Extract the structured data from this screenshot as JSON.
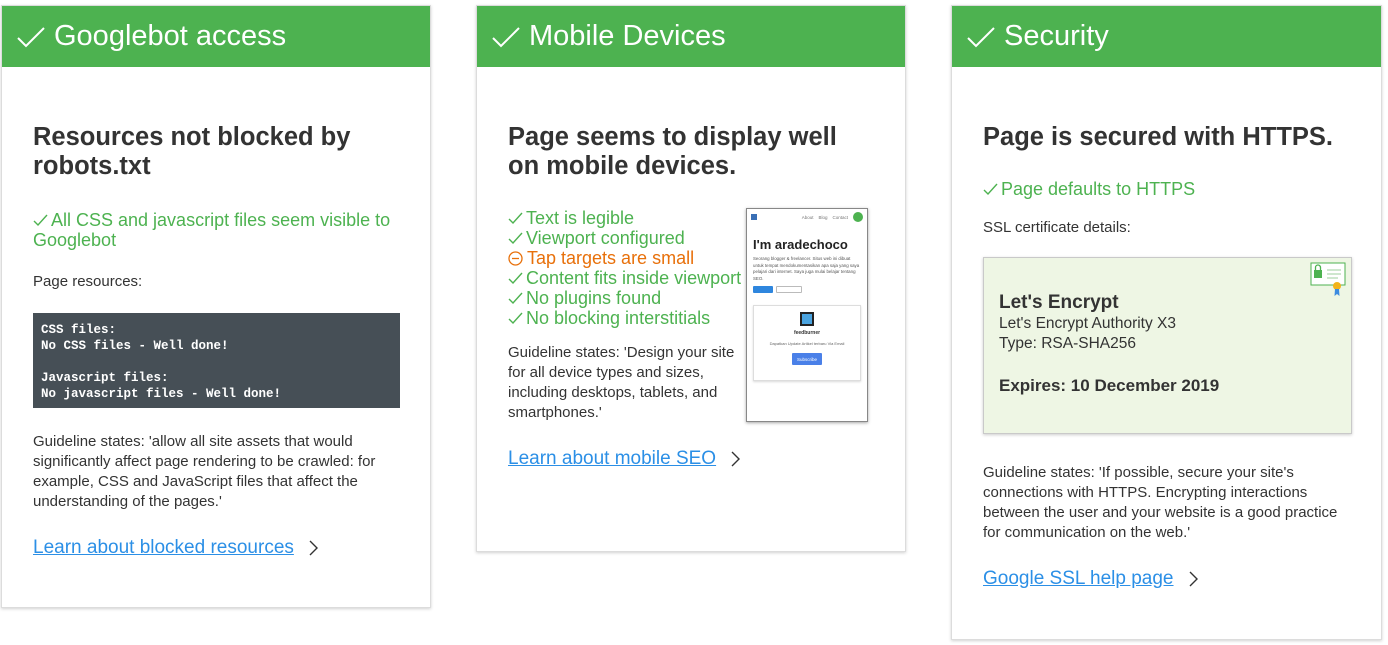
{
  "colors": {
    "accent_green": "#4db250",
    "warning_orange": "#e8700a",
    "link_blue": "#2b8fe6",
    "code_bg": "#464f56",
    "cert_bg": "#eef6e4"
  },
  "googlebot": {
    "header": "Googlebot access",
    "heading": "Resources not blocked by robots.txt",
    "pass": "All CSS and javascript files seem visible to Googlebot",
    "resources_label": "Page resources:",
    "code": {
      "css_label": "CSS files:",
      "css_value": "No CSS files - Well done!",
      "js_label": "Javascript files:",
      "js_value": "No javascript files - Well done!"
    },
    "guideline": "Guideline states: 'allow all site assets that would significantly affect page rendering to be crawled: for example, CSS and JavaScript files that affect the understanding of the pages.'",
    "link": "Learn about blocked resources"
  },
  "mobile": {
    "header": "Mobile Devices",
    "heading": "Page seems to display well on mobile devices.",
    "checks": [
      {
        "status": "pass",
        "label": "Text is legible"
      },
      {
        "status": "pass",
        "label": "Viewport configured"
      },
      {
        "status": "warn",
        "label": "Tap targets are small"
      },
      {
        "status": "pass",
        "label": "Content fits inside viewport"
      },
      {
        "status": "pass",
        "label": "No plugins found"
      },
      {
        "status": "pass",
        "label": "No blocking interstitials"
      }
    ],
    "guideline": "Guideline states: 'Design your site for all device types and sizes, including desktops, tablets, and smartphones.'",
    "link": "Learn about mobile SEO",
    "preview": {
      "nav": [
        "About",
        "Blog",
        "Contact"
      ],
      "title": "I'm aradechoco",
      "text": "Seorang blogger & freelancer. Situs web ini dibuat untuk tempat mendokumentasikan apa saja yang saya pelajari dari internet. Saya juga mulai belajar tentang SEO.",
      "pill_1": "Follow",
      "pill_2": "Followers",
      "feed": "feedburner",
      "feed_desc": "Dapatkan Update Artikel terbaru Via Email",
      "subscribe": "Subscribe"
    }
  },
  "security": {
    "header": "Security",
    "heading": "Page is secured with HTTPS.",
    "pass": "Page defaults to HTTPS",
    "ssl_label": "SSL certificate details:",
    "cert": {
      "issuer": "Let's Encrypt",
      "authority": "Let's Encrypt Authority X3",
      "type": "Type: RSA-SHA256",
      "expires": "Expires: 10 December 2019"
    },
    "guideline": "Guideline states: 'If possible, secure your site's connections with HTTPS. Encrypting interactions between the user and your website is a good practice for communication on the web.'",
    "link": "Google SSL help page"
  }
}
